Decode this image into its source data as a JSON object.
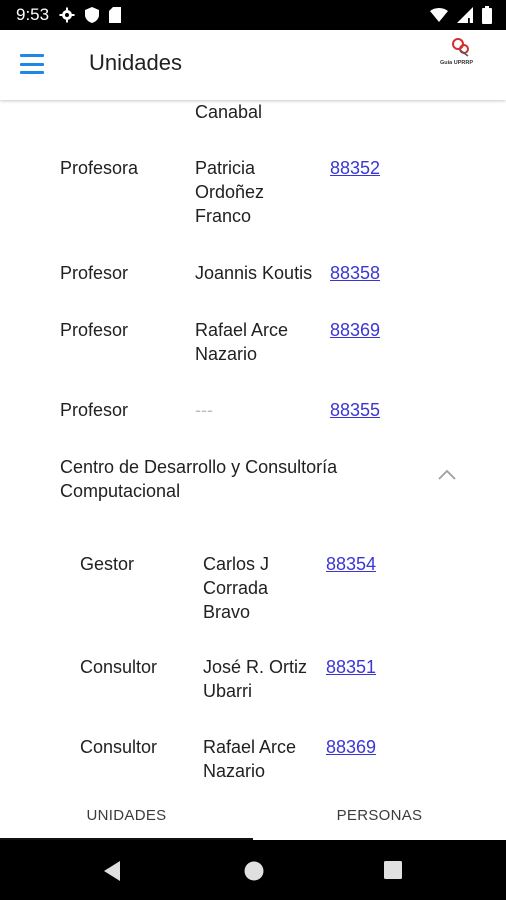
{
  "status_bar": {
    "time": "9:53",
    "icons": [
      "gear-icon",
      "shield-icon",
      "sd-card-icon",
      "wifi-icon",
      "signal-icon",
      "battery-icon"
    ]
  },
  "app_bar": {
    "title": "Unidades",
    "logo_text": "Guía UPRRP"
  },
  "colors": {
    "accent": "#1e88e5",
    "link": "#3a36d6",
    "logo_red": "#d32f2f"
  },
  "list": {
    "top_fragment": "Canabal",
    "entries": [
      {
        "title": "Profesora",
        "name_lines": [
          "Patricia",
          "Ordoñez",
          "Franco"
        ],
        "ext": "88352"
      },
      {
        "title": "Profesor",
        "name_lines": [
          "Joannis Koutis"
        ],
        "ext": "88358"
      },
      {
        "title": "Profesor",
        "name_lines": [
          "Rafael Arce",
          "Nazario"
        ],
        "ext": "88369"
      },
      {
        "title": "Profesor",
        "name_lines": [
          "---"
        ],
        "ext": "88355"
      }
    ],
    "section": {
      "header_lines": [
        "Centro de Desarrollo y Consultoría",
        "Computacional"
      ],
      "expanded": true,
      "entries": [
        {
          "title": "Gestor",
          "name_lines": [
            "Carlos J",
            "Corrada",
            "Bravo"
          ],
          "ext": "88354"
        },
        {
          "title": "Consultor",
          "name_lines": [
            "José R. Ortiz",
            "Ubarri"
          ],
          "ext": "88351"
        },
        {
          "title": "Consultor",
          "name_lines": [
            "Rafael Arce",
            "Nazario"
          ],
          "ext": "88369"
        }
      ]
    }
  },
  "tabs": [
    {
      "label": "UNIDADES",
      "active": true
    },
    {
      "label": "PERSONAS",
      "active": false
    }
  ],
  "nav": [
    "back-icon",
    "home-icon",
    "recents-icon"
  ]
}
